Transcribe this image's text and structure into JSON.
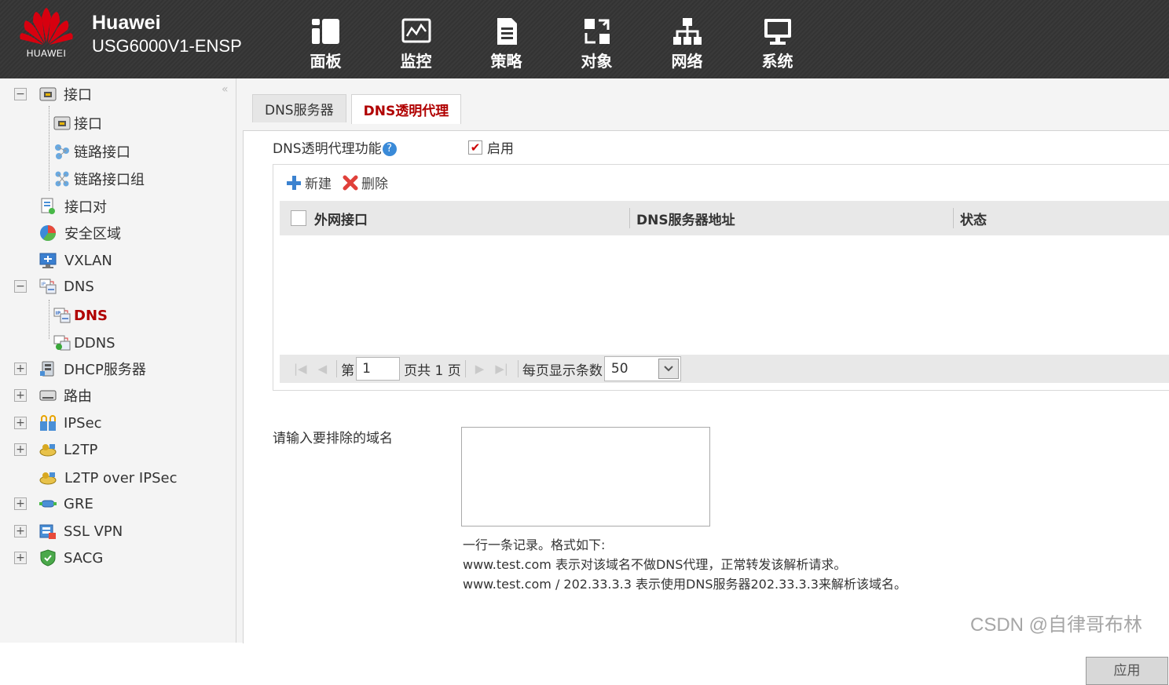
{
  "header": {
    "logo_text": "HUAWEI",
    "brand_name": "Huawei",
    "device_model": "USG6000V1-ENSP",
    "nav": [
      {
        "label": "面板",
        "icon": "dashboard-icon"
      },
      {
        "label": "监控",
        "icon": "monitor-icon"
      },
      {
        "label": "策略",
        "icon": "policy-icon"
      },
      {
        "label": "对象",
        "icon": "object-icon"
      },
      {
        "label": "网络",
        "icon": "network-icon"
      },
      {
        "label": "系统",
        "icon": "system-icon"
      }
    ],
    "active_nav": "网络"
  },
  "sidebar": {
    "collapse_glyph": "«",
    "items": [
      {
        "label": "接口",
        "toggle": "−",
        "icon": "interface-icon"
      },
      {
        "label": "接口",
        "icon": "interface-icon"
      },
      {
        "label": "链路接口",
        "icon": "link-interface-icon"
      },
      {
        "label": "链路接口组",
        "icon": "link-group-icon"
      },
      {
        "label": "接口对",
        "icon": "interface-pair-icon"
      },
      {
        "label": "安全区域",
        "icon": "security-zone-icon"
      },
      {
        "label": "VXLAN",
        "icon": "vxlan-icon"
      },
      {
        "label": "DNS",
        "toggle": "−",
        "icon": "dns-icon"
      },
      {
        "label": "DNS",
        "icon": "dns-icon",
        "active": true
      },
      {
        "label": "DDNS",
        "icon": "ddns-icon"
      },
      {
        "label": "DHCP服务器",
        "toggle": "+",
        "icon": "dhcp-icon"
      },
      {
        "label": "路由",
        "toggle": "+",
        "icon": "router-icon"
      },
      {
        "label": "IPSec",
        "toggle": "+",
        "icon": "ipsec-icon"
      },
      {
        "label": "L2TP",
        "toggle": "+",
        "icon": "l2tp-icon"
      },
      {
        "label": "L2TP over IPSec",
        "icon": "l2tp-ipsec-icon"
      },
      {
        "label": "GRE",
        "toggle": "+",
        "icon": "gre-icon"
      },
      {
        "label": "SSL VPN",
        "toggle": "+",
        "icon": "ssl-vpn-icon"
      },
      {
        "label": "SACG",
        "toggle": "+",
        "icon": "sacg-icon"
      }
    ]
  },
  "tabs": [
    {
      "label": "DNS服务器"
    },
    {
      "label": "DNS透明代理",
      "active": true
    }
  ],
  "feature": {
    "label": "DNS透明代理功能",
    "help": "?",
    "enable_label": "启用",
    "enabled": true,
    "check_glyph": "✔"
  },
  "grid": {
    "toolbar": {
      "new_label": "新建",
      "delete_label": "删除"
    },
    "columns": [
      "外网接口",
      "DNS服务器地址",
      "状态"
    ],
    "rows": [],
    "pager": {
      "page_prefix": "第",
      "page_value": "1",
      "page_total_text": "页共 1 页",
      "per_page_label": "每页显示条数",
      "per_page_value": "50",
      "first": "|◀",
      "prev": "◀",
      "next": "▶",
      "last": "▶|"
    }
  },
  "exclude": {
    "label": "请输入要排除的域名",
    "value": "",
    "hint_lines": [
      "一行一条记录。格式如下:",
      "www.test.com 表示对该域名不做DNS代理，正常转发该解析请求。",
      "www.test.com / 202.33.3.3 表示使用DNS服务器202.33.3.3来解析该域名。"
    ]
  },
  "apply_label": "应用",
  "watermark": "CSDN @自律哥布林",
  "colors": {
    "accent": "#b00000",
    "header_bg": "#383838",
    "logo_red": "#d7000f"
  }
}
